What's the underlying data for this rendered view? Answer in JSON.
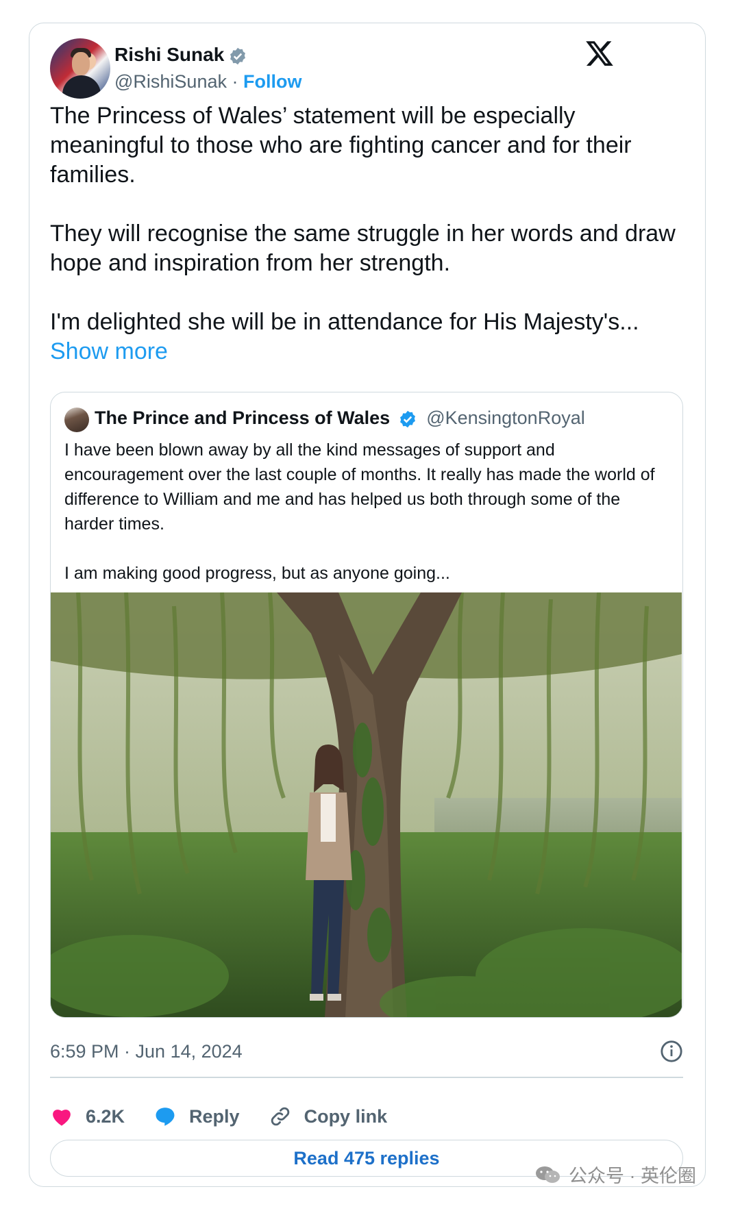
{
  "author": {
    "name": "Rishi Sunak",
    "handle": "@RishiSunak",
    "separator": "·",
    "follow_label": "Follow"
  },
  "tweet": {
    "text": "The Princess of Wales’ statement will be especially meaningful to those who are fighting cancer and for their families.\n\nThey will recognise the same struggle in her words and draw hope and inspiration from her strength.\n\nI'm delighted she will be in attendance for His Majesty's... ",
    "show_more_label": "Show more"
  },
  "quoted": {
    "name": "The Prince and Princess of Wales",
    "handle": "@KensingtonRoyal",
    "text": "I have been blown away by all the kind messages of support and encouragement over the last couple of months. It really has made the world of difference to William and me and has helped us both through some of the harder times.\n\nI am making good progress, but as anyone going..."
  },
  "meta": {
    "timestamp": "6:59 PM · Jun 14, 2024"
  },
  "actions": {
    "likes": "6.2K",
    "reply_label": "Reply",
    "copy_label": "Copy link"
  },
  "read_replies_label": "Read 475 replies",
  "watermark": {
    "text": "公众号 · 英伦圈"
  },
  "colors": {
    "accent": "#1d9bf0",
    "like": "#f91880",
    "muted": "#536471",
    "border": "#cfd9de"
  }
}
